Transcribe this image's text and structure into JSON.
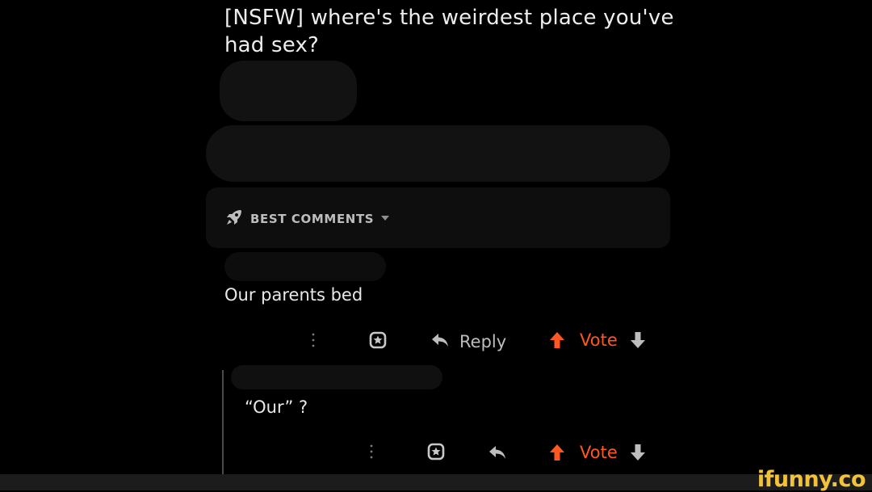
{
  "post": {
    "title": "[NSFW] where's the weirdest place you've had sex?"
  },
  "sort": {
    "label": "BEST COMMENTS",
    "icon": "rocket-icon"
  },
  "comments": [
    {
      "text": "Our parents bed",
      "actions": {
        "more_icon": "more-vertical-icon",
        "award_icon": "award-icon",
        "reply_icon": "reply-icon",
        "reply_label": "Reply",
        "vote_label": "Vote"
      }
    },
    {
      "text": "“Our” ?",
      "actions": {
        "more_icon": "more-vertical-icon",
        "award_icon": "award-icon",
        "reply_icon": "reply-icon",
        "vote_label": "Vote"
      }
    }
  ],
  "colors": {
    "background": "#000000",
    "vote_accent": "#ff5722",
    "watermark": "#f2c33a"
  },
  "watermark": {
    "text": "ifunny.co"
  }
}
